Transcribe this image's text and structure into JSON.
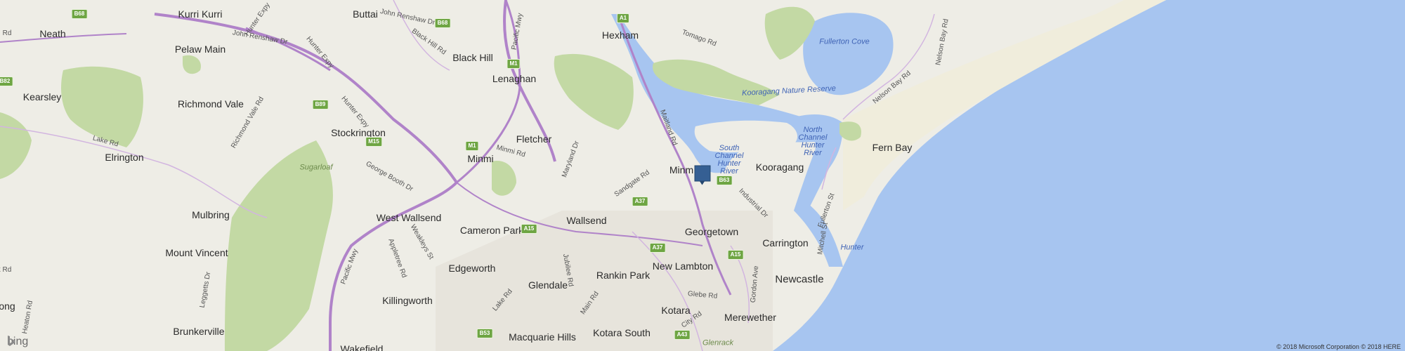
{
  "map": {
    "marker": {
      "name": "location-marker"
    },
    "suburbs": [
      "Kurri Kurri",
      "Buttai",
      "Neath",
      "Pelaw Main",
      "Hexham",
      "Black Hill",
      "Lenaghan",
      "Kearsley",
      "Richmond Vale",
      "Stockrington",
      "Fletcher",
      "Minmi",
      "Elrington",
      "Mulbring",
      "West Wallsend",
      "Wallsend",
      "Cameron Park",
      "Georgetown",
      "Carrington",
      "Fern Bay",
      "Kooragang",
      "Minm",
      "Edgeworth",
      "Rankin Park",
      "New Lambton",
      "Mount Vincent",
      "Killingworth",
      "Glendale",
      "Kotara",
      "Merewether",
      "Brunkerville",
      "Macquarie Hills",
      "Kotara South",
      "Wakefield",
      "ong"
    ],
    "city": "Newcastle",
    "roads": [
      "John Renshaw Dr",
      "John Renshaw Dr",
      "Hunter Expy",
      "Hunter Expy",
      "Pacific Mwy",
      "Pacific Mwy",
      "Black Hill Rd",
      "Tomago Rd",
      "Nelson Bay Rd",
      "Nelson Bay Rd",
      "Maitland Rd",
      "Lake Rd",
      "Richmond Vale Rd",
      "Hunter Expy",
      "George Booth Dr",
      "Minmi Rd",
      "Maryland Dr",
      "Sandgate Rd",
      "Industrial Dr",
      "Fullerton St",
      "Mitchell St",
      "Maitland Rd",
      "Weakleys St",
      "Appletree Rd",
      "Leggetts Dr",
      "Heaton Rd",
      "Lake Rd",
      "Jubilee Rd",
      "Main Rd",
      "Glebe Rd",
      "Gordon Ave",
      "City Rd",
      "k Rd",
      "Rd"
    ],
    "water": [
      "Fullerton Cove",
      "Kooragang Nature Reserve",
      "North Channel Hunter River",
      "South Channel Hunter River",
      "Hunter"
    ],
    "parks": [
      "Sugarloaf",
      "Glenrack"
    ],
    "shields": [
      "B68",
      "B68",
      "A1",
      "M1",
      "M1",
      "M15",
      "B89",
      "B82",
      "A37",
      "A37",
      "A15",
      "A15",
      "B63",
      "A43",
      "B53"
    ]
  },
  "branding": {
    "logo_text": "bing"
  },
  "copyright": "© 2018 Microsoft Corporation © 2018 HERE",
  "colors": {
    "land": "#eeede6",
    "sea": "#a7c5f0",
    "park": "#c3d9a4",
    "motorway": "#b083c9",
    "marker": "#355f93"
  }
}
